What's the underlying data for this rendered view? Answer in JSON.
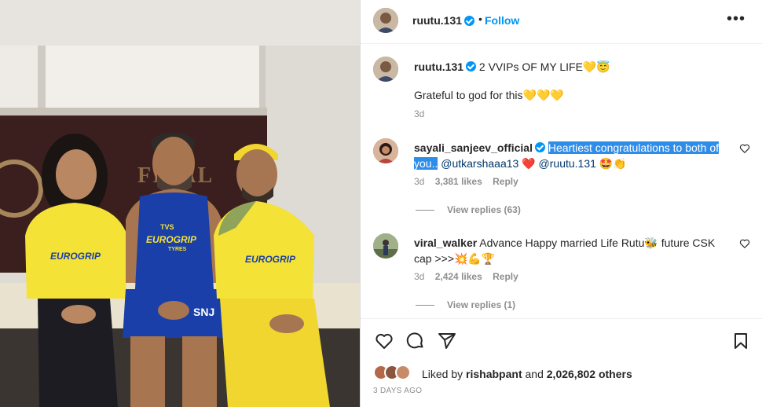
{
  "post": {
    "author": "ruutu.131",
    "follow_label": "Follow",
    "more_label": "•••",
    "separator": "•",
    "photo_banner_text": "FINAL",
    "jersey_sponsor": "EUROGRIP",
    "jersey_sponsor_sub": "TYRES",
    "jersey_brand": "TVS",
    "jersey_tag": "SNJ",
    "caption": {
      "username": "ruutu.131",
      "text": " 2 VVIPs OF MY LIFE💛😇",
      "line2": "Grateful to god for this💛💛💛",
      "time": "3d"
    }
  },
  "comments": [
    {
      "username": "sayali_sanjeev_official",
      "highlighted_text": "Heartiest congratulations to both of you..",
      "mention1": "@utkarshaaa13",
      "emoji1": " ❤️ ",
      "mention2": "@ruutu.131",
      "emoji2": " 🤩👏",
      "time": "3d",
      "likes": "3,381 likes",
      "reply": "Reply",
      "view_replies": "View replies (63)"
    },
    {
      "username": "viral_walker",
      "text": " Advance Happy married Life Rutu🐝 future CSK cap >>>💥💪🏆",
      "time": "3d",
      "likes": "2,424 likes",
      "reply": "Reply",
      "view_replies": "View replies (1)"
    }
  ],
  "engagement": {
    "liked_by_prefix": "Liked by ",
    "liked_by_user": "rishabpant",
    "liked_by_suffix": " and ",
    "liked_by_count": "2,026,802 others",
    "posted": "3 DAYS AGO"
  },
  "icons": {
    "verified": "verified-badge-icon",
    "heart": "heart-icon",
    "comment": "comment-icon",
    "share": "share-icon",
    "save": "bookmark-icon"
  },
  "colors": {
    "accent": "#0095f6",
    "highlight": "#2f8dea",
    "csk_yellow": "#f7e43a",
    "csk_blue": "#1b3fa8"
  }
}
